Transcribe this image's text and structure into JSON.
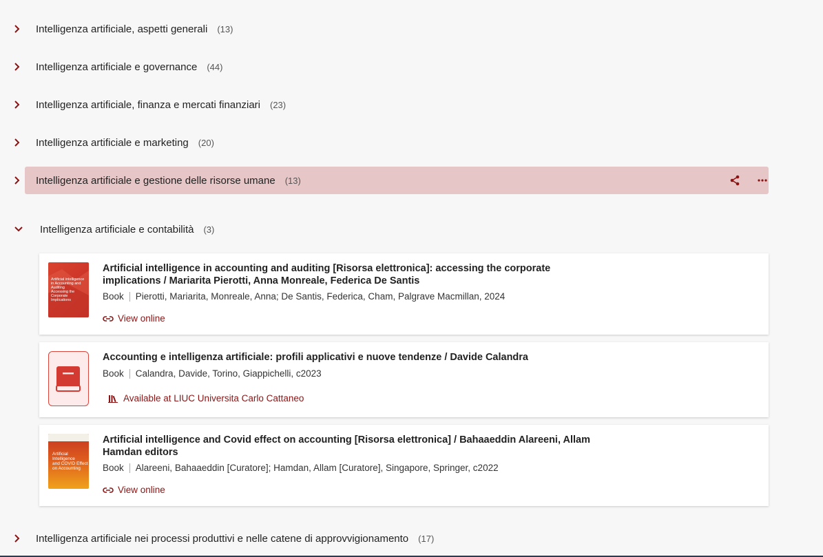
{
  "facets": [
    {
      "label": "Intelligenza artificiale, aspetti generali",
      "count": "(13)"
    },
    {
      "label": "Intelligenza artificiale e governance",
      "count": "(44)"
    },
    {
      "label": "Intelligenza artificiale, finanza e mercati finanziari",
      "count": "(23)"
    },
    {
      "label": "Intelligenza artificiale e marketing",
      "count": "(20)"
    },
    {
      "label": "Intelligenza artificiale e gestione delle risorse umane",
      "count": "(13)"
    }
  ],
  "expanded": {
    "label": "Intelligenza artificiale e contabilità",
    "count": "(3)"
  },
  "results": [
    {
      "title": "Artificial intelligence in accounting and auditing [Risorsa elettronica]: accessing the corporate implications / Mariarita Pierotti, Anna Monreale, Federica De Santis",
      "type": "Book",
      "details": "Pierotti, Mariarita, Monreale, Anna; De Santis, Federica, Cham, Palgrave Macmillan, 2024",
      "action": "View online",
      "cover_lines": [
        "Artificial intelligence",
        "in Accounting and",
        "Auditing",
        "Accessing the",
        "Corporate Implications"
      ]
    },
    {
      "title": "Accounting e intelligenza artificiale: profili applicativi e nuove tendenze / Davide Calandra",
      "type": "Book",
      "details": "Calandra, Davide, Torino, Giappichelli, c2023",
      "action": "Available at LIUC Universita Carlo Cattaneo"
    },
    {
      "title": "Artificial intelligence and Covid effect on accounting [Risorsa elettronica] / Bahaaeddin Alareeni, Allam Hamdan editors",
      "type": "Book",
      "details": "Alareeni, Bahaaeddin [Curatore]; Hamdan, Allam [Curatore], Singapore, Springer, c2022",
      "action": "View online",
      "cover_lines": [
        "Artificial",
        "Intelligence",
        "and COVID Effect",
        "on Accounting"
      ]
    }
  ],
  "last_facet": {
    "label": "Intelligenza artificiale nei processi produttivi e nelle catene di approvvigionamento",
    "count": "(17)"
  },
  "colors": {
    "accent": "#8a1414",
    "highlight": "#e6c6c6"
  }
}
